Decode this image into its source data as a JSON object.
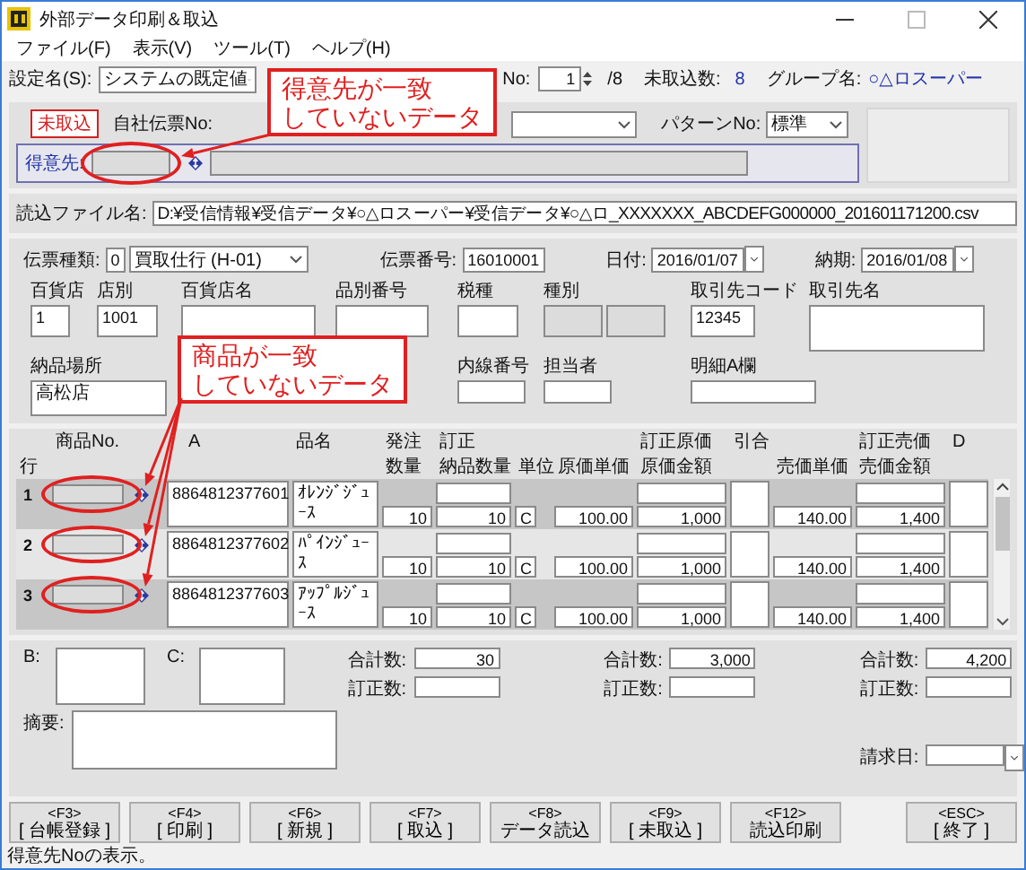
{
  "window": {
    "title": "外部データ印刷＆取込"
  },
  "menu": [
    "ファイル(F)",
    "表示(V)",
    "ツール(T)",
    "ヘルプ(H)"
  ],
  "header": {
    "setting_label": "設定名(S):",
    "setting_value": "システムの既定値",
    "no_label": "No:",
    "no_value": "1",
    "no_total": "/8",
    "pending_label": "未取込数:",
    "pending_value": "8",
    "group_label": "グループ名:",
    "group_value": "○△ロスーパー"
  },
  "import_panel": {
    "badge": "未取込",
    "slip_no_label": "自社伝票No:",
    "pattern_label": "パターンNo:",
    "pattern_value": "標準",
    "customer_label": "得意先:",
    "customer_flagged": true
  },
  "file": {
    "label": "読込ファイル名:",
    "path": "D:¥受信情報¥受信データ¥○△ロスーパー¥受信データ¥○△ロ_XXXXXXX_ABCDEFG000000_201601171200.csv"
  },
  "slip": {
    "type_label": "伝票種類:",
    "type_code": "0",
    "type_value": "買取仕行 (H-01)",
    "number_label": "伝票番号:",
    "number": "16010001",
    "date_label": "日付:",
    "date": "2016/01/07",
    "due_label": "納期:",
    "due": "2016/01/08"
  },
  "info_fields": [
    {
      "label": "百貨店",
      "value": "1",
      "disabled": false
    },
    {
      "label": "店別",
      "value": "1001",
      "disabled": false
    },
    {
      "label": "百貨店名",
      "disabled": false
    },
    {
      "label": "品別番号",
      "disabled": false
    },
    {
      "label": "税種",
      "disabled": false
    },
    {
      "label": "種別",
      "disabled": true
    },
    {
      "label": "取引先コード",
      "value": "12345",
      "disabled": false
    },
    {
      "label": "取引先名",
      "disabled": false
    }
  ],
  "info_fields_2": [
    {
      "label": "納品場所",
      "value": "高松店"
    },
    {
      "label": "内線番号"
    },
    {
      "label": "担当者"
    },
    {
      "label": "明細A欄"
    }
  ],
  "table": {
    "columns": [
      {
        "bottom": "行"
      },
      {
        "top": "商品No."
      },
      {
        "top": "A"
      },
      {
        "top": "品名"
      },
      {
        "top": "発注",
        "bottom": "数量"
      },
      {
        "top": "訂正",
        "bottom": "納品数量"
      },
      {
        "bottom": "単位"
      },
      {
        "bottom": "原価単価"
      },
      {
        "top": "訂正原価",
        "bottom": "原価金額"
      },
      {
        "top": "引合"
      },
      {
        "bottom": "売価単価"
      },
      {
        "top": "訂正売価",
        "bottom": "売価金額"
      },
      {
        "top": "D"
      }
    ],
    "rows": [
      {
        "no": "1",
        "flagged": true,
        "jan": "8864812377601",
        "name": "ｵﾚﾝｼﾞｼﾞｭｰｽ",
        "qty": "10",
        "corrected_qty": "10",
        "unit": "C",
        "cost": "100.00",
        "cost_amount": "1,000",
        "price": "140.00",
        "price_amount": "1,400"
      },
      {
        "no": "2",
        "flagged": true,
        "jan": "8864812377602",
        "name": "ﾊﾟｲﾝｼﾞｭｰｽ",
        "qty": "10",
        "corrected_qty": "10",
        "unit": "C",
        "cost": "100.00",
        "cost_amount": "1,000",
        "price": "140.00",
        "price_amount": "1,400"
      },
      {
        "no": "3",
        "flagged": true,
        "jan": "8864812377603",
        "name": "ｱｯﾌﾟﾙｼﾞｭｰｽ",
        "qty": "10",
        "corrected_qty": "10",
        "unit": "C",
        "cost": "100.00",
        "cost_amount": "1,000",
        "price": "140.00",
        "price_amount": "1,400"
      }
    ]
  },
  "footer": {
    "b_label": "B:",
    "c_label": "C:",
    "memo_label": "摘要:",
    "billing_label": "請求日:",
    "totals": [
      {
        "label": "合計数:",
        "value": "30",
        "corrected_label": "訂正数:"
      },
      {
        "label": "合計数:",
        "value": "3,000",
        "corrected_label": "訂正数:"
      },
      {
        "label": "合計数:",
        "value": "4,200",
        "corrected_label": "訂正数:"
      }
    ]
  },
  "buttons": [
    {
      "key": "<F3>",
      "label": "[ 台帳登録 ]"
    },
    {
      "key": "<F4>",
      "label": "[ 印刷 ]"
    },
    {
      "key": "<F6>",
      "label": "[ 新規 ]"
    },
    {
      "key": "<F7>",
      "label": "[ 取込 ]"
    },
    {
      "key": "<F8>",
      "label": "データ読込"
    },
    {
      "key": "<F9>",
      "label": "[ 未取込 ]"
    },
    {
      "key": "<F12>",
      "label": "読込印刷"
    },
    {
      "key": "<ESC>",
      "label": "[ 終了 ]"
    }
  ],
  "status_bar": "得意先Noの表示。",
  "callouts": [
    {
      "lines": [
        "得意先が一致",
        "していないデータ"
      ]
    },
    {
      "lines": [
        "商品が一致",
        "していないデータ"
      ]
    }
  ]
}
